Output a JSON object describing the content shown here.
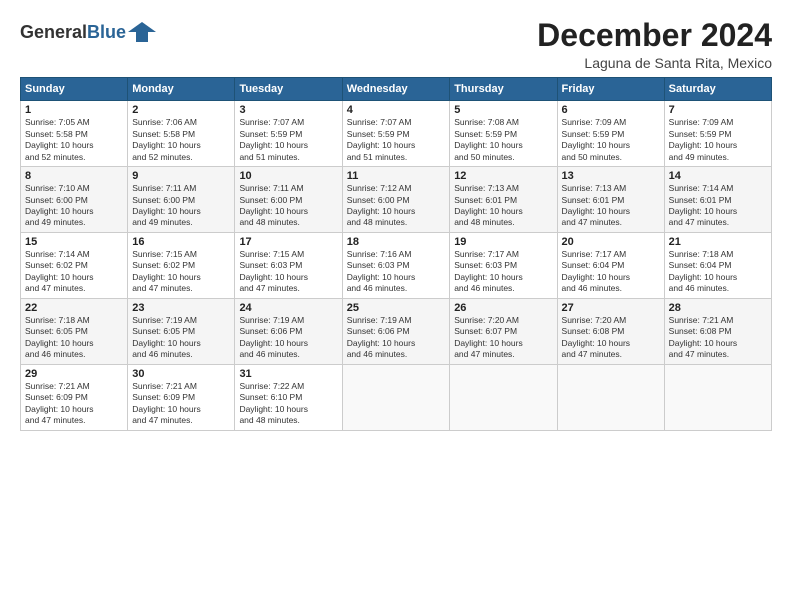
{
  "header": {
    "title": "December 2024",
    "location": "Laguna de Santa Rita, Mexico"
  },
  "days": [
    "Sunday",
    "Monday",
    "Tuesday",
    "Wednesday",
    "Thursday",
    "Friday",
    "Saturday"
  ],
  "weeks": [
    [
      {
        "day": "1",
        "info": "Sunrise: 7:05 AM\nSunset: 5:58 PM\nDaylight: 10 hours\nand 52 minutes."
      },
      {
        "day": "2",
        "info": "Sunrise: 7:06 AM\nSunset: 5:58 PM\nDaylight: 10 hours\nand 52 minutes."
      },
      {
        "day": "3",
        "info": "Sunrise: 7:07 AM\nSunset: 5:59 PM\nDaylight: 10 hours\nand 51 minutes."
      },
      {
        "day": "4",
        "info": "Sunrise: 7:07 AM\nSunset: 5:59 PM\nDaylight: 10 hours\nand 51 minutes."
      },
      {
        "day": "5",
        "info": "Sunrise: 7:08 AM\nSunset: 5:59 PM\nDaylight: 10 hours\nand 50 minutes."
      },
      {
        "day": "6",
        "info": "Sunrise: 7:09 AM\nSunset: 5:59 PM\nDaylight: 10 hours\nand 50 minutes."
      },
      {
        "day": "7",
        "info": "Sunrise: 7:09 AM\nSunset: 5:59 PM\nDaylight: 10 hours\nand 49 minutes."
      }
    ],
    [
      {
        "day": "8",
        "info": "Sunrise: 7:10 AM\nSunset: 6:00 PM\nDaylight: 10 hours\nand 49 minutes."
      },
      {
        "day": "9",
        "info": "Sunrise: 7:11 AM\nSunset: 6:00 PM\nDaylight: 10 hours\nand 49 minutes."
      },
      {
        "day": "10",
        "info": "Sunrise: 7:11 AM\nSunset: 6:00 PM\nDaylight: 10 hours\nand 48 minutes."
      },
      {
        "day": "11",
        "info": "Sunrise: 7:12 AM\nSunset: 6:00 PM\nDaylight: 10 hours\nand 48 minutes."
      },
      {
        "day": "12",
        "info": "Sunrise: 7:13 AM\nSunset: 6:01 PM\nDaylight: 10 hours\nand 48 minutes."
      },
      {
        "day": "13",
        "info": "Sunrise: 7:13 AM\nSunset: 6:01 PM\nDaylight: 10 hours\nand 47 minutes."
      },
      {
        "day": "14",
        "info": "Sunrise: 7:14 AM\nSunset: 6:01 PM\nDaylight: 10 hours\nand 47 minutes."
      }
    ],
    [
      {
        "day": "15",
        "info": "Sunrise: 7:14 AM\nSunset: 6:02 PM\nDaylight: 10 hours\nand 47 minutes."
      },
      {
        "day": "16",
        "info": "Sunrise: 7:15 AM\nSunset: 6:02 PM\nDaylight: 10 hours\nand 47 minutes."
      },
      {
        "day": "17",
        "info": "Sunrise: 7:15 AM\nSunset: 6:03 PM\nDaylight: 10 hours\nand 47 minutes."
      },
      {
        "day": "18",
        "info": "Sunrise: 7:16 AM\nSunset: 6:03 PM\nDaylight: 10 hours\nand 46 minutes."
      },
      {
        "day": "19",
        "info": "Sunrise: 7:17 AM\nSunset: 6:03 PM\nDaylight: 10 hours\nand 46 minutes."
      },
      {
        "day": "20",
        "info": "Sunrise: 7:17 AM\nSunset: 6:04 PM\nDaylight: 10 hours\nand 46 minutes."
      },
      {
        "day": "21",
        "info": "Sunrise: 7:18 AM\nSunset: 6:04 PM\nDaylight: 10 hours\nand 46 minutes."
      }
    ],
    [
      {
        "day": "22",
        "info": "Sunrise: 7:18 AM\nSunset: 6:05 PM\nDaylight: 10 hours\nand 46 minutes."
      },
      {
        "day": "23",
        "info": "Sunrise: 7:19 AM\nSunset: 6:05 PM\nDaylight: 10 hours\nand 46 minutes."
      },
      {
        "day": "24",
        "info": "Sunrise: 7:19 AM\nSunset: 6:06 PM\nDaylight: 10 hours\nand 46 minutes."
      },
      {
        "day": "25",
        "info": "Sunrise: 7:19 AM\nSunset: 6:06 PM\nDaylight: 10 hours\nand 46 minutes."
      },
      {
        "day": "26",
        "info": "Sunrise: 7:20 AM\nSunset: 6:07 PM\nDaylight: 10 hours\nand 47 minutes."
      },
      {
        "day": "27",
        "info": "Sunrise: 7:20 AM\nSunset: 6:08 PM\nDaylight: 10 hours\nand 47 minutes."
      },
      {
        "day": "28",
        "info": "Sunrise: 7:21 AM\nSunset: 6:08 PM\nDaylight: 10 hours\nand 47 minutes."
      }
    ],
    [
      {
        "day": "29",
        "info": "Sunrise: 7:21 AM\nSunset: 6:09 PM\nDaylight: 10 hours\nand 47 minutes."
      },
      {
        "day": "30",
        "info": "Sunrise: 7:21 AM\nSunset: 6:09 PM\nDaylight: 10 hours\nand 47 minutes."
      },
      {
        "day": "31",
        "info": "Sunrise: 7:22 AM\nSunset: 6:10 PM\nDaylight: 10 hours\nand 48 minutes."
      },
      {
        "day": "",
        "info": ""
      },
      {
        "day": "",
        "info": ""
      },
      {
        "day": "",
        "info": ""
      },
      {
        "day": "",
        "info": ""
      }
    ]
  ]
}
